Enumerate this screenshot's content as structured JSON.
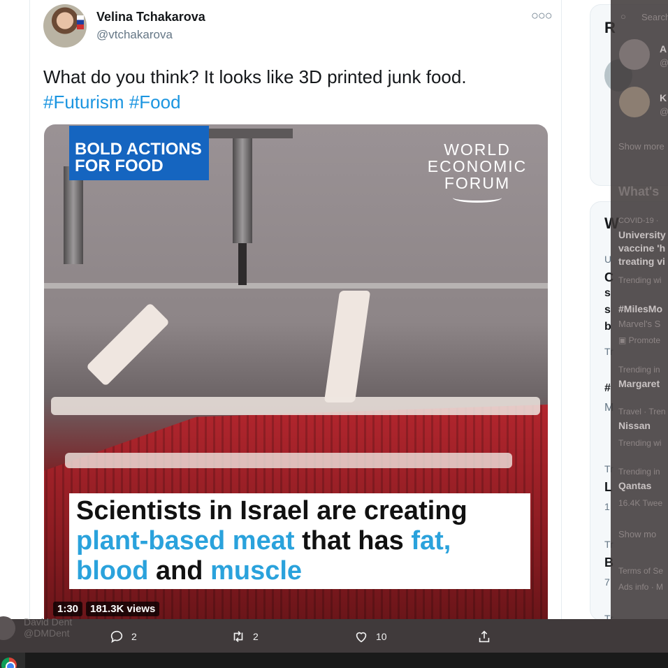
{
  "tweet": {
    "author_name": "Velina Tchakarova",
    "author_handle": "@vtchakarova",
    "more_icon": "more-horizontal-icon",
    "text_line1": "What do you think? It looks like 3D printed junk food.",
    "hashtags": [
      "#Futurism",
      "#Food"
    ]
  },
  "video": {
    "badge_line1": "BOLD ACTIONS",
    "badge_line2": "FOR FOOD",
    "logo_line1": "WORLD",
    "logo_line2": "ECONOMIC",
    "logo_line3": "FORUM",
    "caption_line1": "Scientists in Israel are creating",
    "caption_line2_blue": "plant-based meat",
    "caption_line2_rest": " that has ",
    "caption_line2_blue2": "fat,",
    "caption_line3_blue": "blood",
    "caption_line3_rest": " and ",
    "caption_line3_blue2": "muscle",
    "duration": "1:30",
    "views": "181.3K views"
  },
  "actions": {
    "reply_count": "2",
    "retweet_count": "2",
    "like_count": "10"
  },
  "behind": {
    "name": "David Dent",
    "handle": "@DMDent"
  },
  "right_panel": {
    "who_letter": "R",
    "whats_letter": "W",
    "items": [
      "U",
      "C",
      "s",
      "s",
      "b",
      "Tr",
      "#",
      "M",
      "Tr",
      "L",
      "1",
      "Tr",
      "B",
      "7",
      "Tr"
    ]
  },
  "overlay": {
    "search": "Search",
    "follow1_initial": "A",
    "follow1_sub": "@",
    "follow2_initial": "K",
    "follow2_sub": "@",
    "show_more1": "Show more",
    "whats_heading": "What's",
    "t1_meta": "COVID-19 ·",
    "t1_title_1": "University",
    "t1_title_2": "vaccine 'h",
    "t1_title_3": "treating vi",
    "t1_sub": "Trending wi",
    "t2_title": "#MilesMo",
    "t2_sub": "Marvel's S",
    "t2_promo": "Promote",
    "t3_meta": "Trending in",
    "t3_title": "Margaret",
    "t4_meta": "Travel · Tren",
    "t4_title": "Nissan",
    "t4_sub": "Trending wi",
    "t5_meta": "Trending in",
    "t5_title": "Qantas",
    "t5_sub": "16.4K Twee",
    "show_more2": "Show mo",
    "footer1": "Terms of Se",
    "footer2": "Ads info · M"
  }
}
